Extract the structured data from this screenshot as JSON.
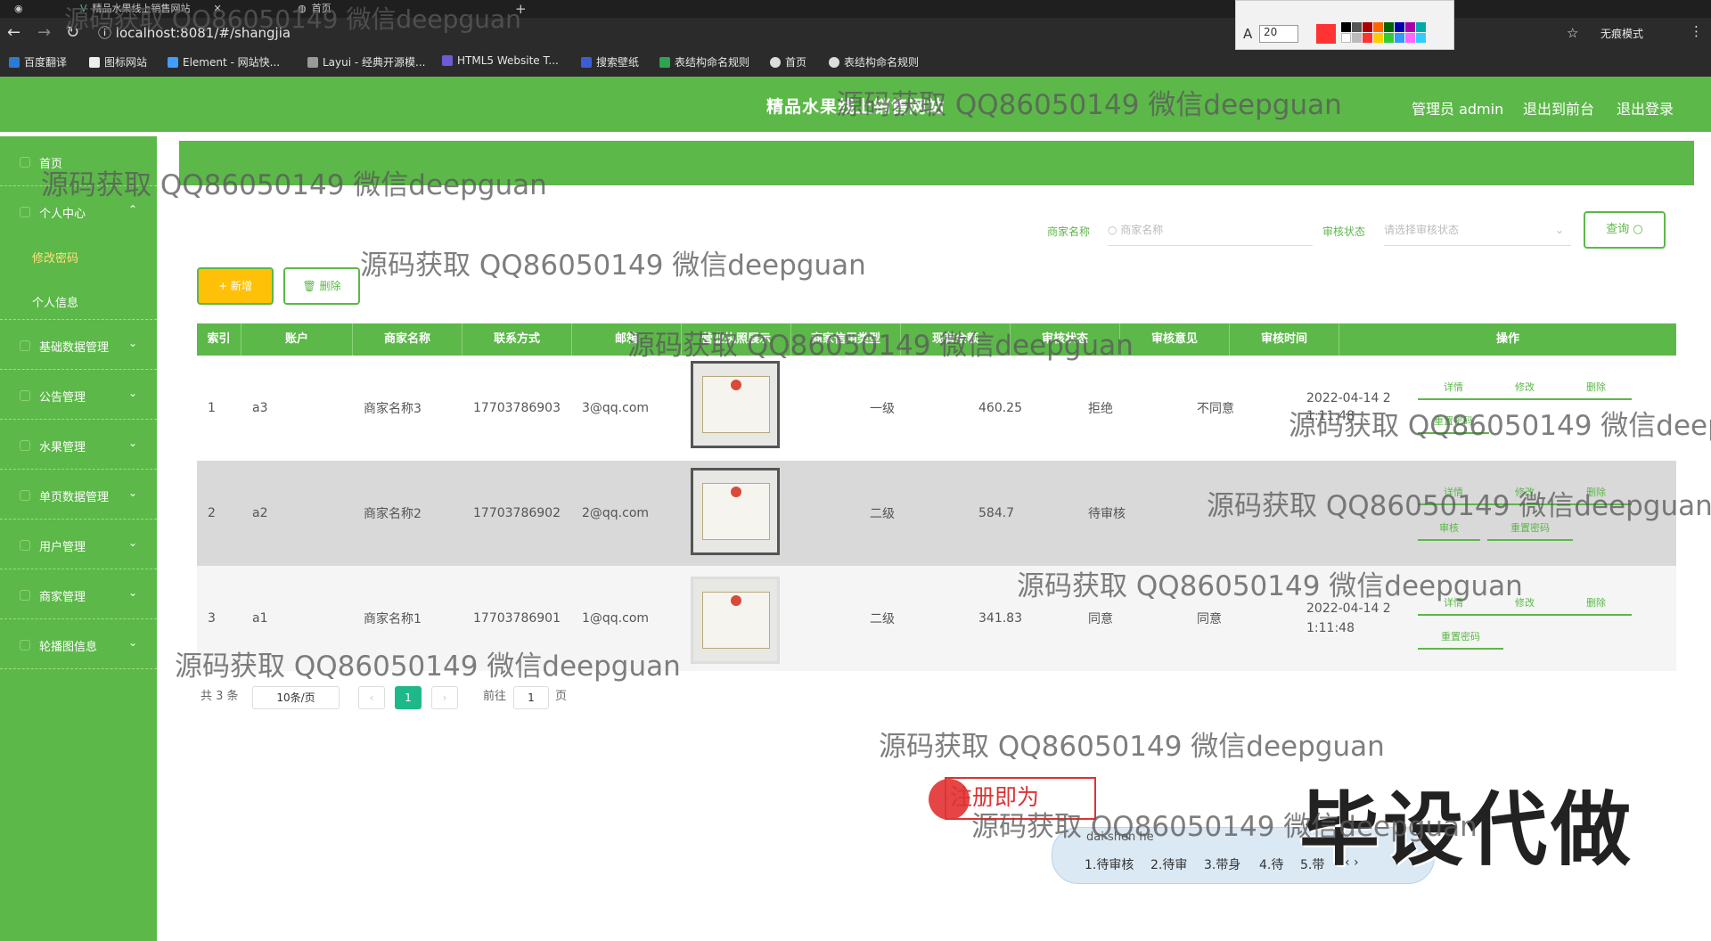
{
  "browser": {
    "tab1": "精品水果线上销售网站",
    "tab2": "首页",
    "url": "localhost:8081/#/shangjia",
    "incognito": "无痕模式",
    "font_size": "20"
  },
  "bookmarks": [
    "百度翻译",
    "图标网站",
    "Element - 网站快...",
    "Layui - 经典开源模...",
    "HTML5 Website T...",
    "搜索壁纸",
    "表结构命名规则",
    "首页",
    "表结构命名规则"
  ],
  "header": {
    "title": "精品水果线上销售网站",
    "admin": "管理员 admin",
    "front": "退出到前台",
    "logout": "退出登录"
  },
  "sidebar": [
    {
      "label": "首页",
      "chevron": ""
    },
    {
      "label": "个人中心",
      "chevron": "^"
    },
    {
      "label": "修改密码",
      "chevron": "",
      "sub": true,
      "active": true
    },
    {
      "label": "个人信息",
      "chevron": "",
      "sub": true
    },
    {
      "label": "基础数据管理",
      "chevron": "v"
    },
    {
      "label": "公告管理",
      "chevron": "v"
    },
    {
      "label": "水果管理",
      "chevron": "v"
    },
    {
      "label": "单页数据管理",
      "chevron": "v"
    },
    {
      "label": "用户管理",
      "chevron": "v"
    },
    {
      "label": "商家管理",
      "chevron": "v"
    },
    {
      "label": "轮播图信息",
      "chevron": "v"
    }
  ],
  "filter": {
    "name_label": "商家名称",
    "name_placeholder": "商家名称",
    "status_label": "审核状态",
    "status_placeholder": "请选择审核状态",
    "query": "查询"
  },
  "actions": {
    "add": "+ 新增",
    "delete": "删除"
  },
  "columns": [
    "索引",
    "账户",
    "商家名称",
    "联系方式",
    "邮箱",
    "营业执照展示",
    "商家信用类型",
    "现有余额",
    "审核状态",
    "审核意见",
    "审核时间",
    "操作"
  ],
  "rows": [
    {
      "idx": "1",
      "account": "a3",
      "name": "商家名称3",
      "phone": "17703786903",
      "email": "3@qq.com",
      "credit": "一级",
      "balance": "460.25",
      "status": "拒绝",
      "opinion": "不同意",
      "time1": "2022-04-14 2",
      "time2": "1:11:48",
      "ops": [
        "详情",
        "修改",
        "删除",
        "重置密码"
      ]
    },
    {
      "idx": "2",
      "account": "a2",
      "name": "商家名称2",
      "phone": "17703786902",
      "email": "2@qq.com",
      "credit": "二级",
      "balance": "584.7",
      "status": "待审核",
      "opinion": "",
      "time1": "",
      "time2": "",
      "ops": [
        "详情",
        "修改",
        "删除",
        "审核",
        "重置密码"
      ]
    },
    {
      "idx": "3",
      "account": "a1",
      "name": "商家名称1",
      "phone": "17703786901",
      "email": "1@qq.com",
      "credit": "二级",
      "balance": "341.83",
      "status": "同意",
      "opinion": "同意",
      "time1": "2022-04-14 2",
      "time2": "1:11:48",
      "ops": [
        "详情",
        "修改",
        "删除",
        "重置密码"
      ]
    }
  ],
  "pager": {
    "total": "共 3 条",
    "size": "10条/页",
    "current": "1",
    "goto": "前往",
    "page_input": "1",
    "page_unit": "页"
  },
  "watermark": "源码获取 QQ86050149 微信deepguan",
  "ime": {
    "pinyin": "dai shen he",
    "candidates": [
      "1.待审核",
      "2.待审",
      "3.带身",
      "4.待",
      "5.带"
    ]
  },
  "overlay": {
    "big": "毕设代做",
    "red": "注册即为"
  },
  "colors": {
    "brand": "#5cb849",
    "add": "#ffc107"
  }
}
